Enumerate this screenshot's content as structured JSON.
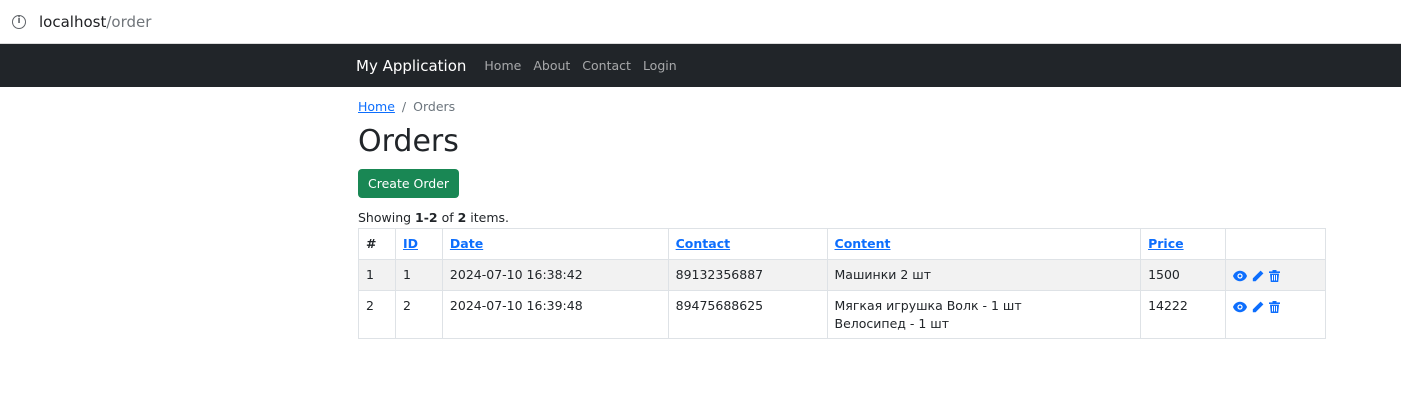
{
  "browser": {
    "url_host": "localhost",
    "url_path": "/order"
  },
  "navbar": {
    "brand": "My Application",
    "links": [
      "Home",
      "About",
      "Contact",
      "Login"
    ]
  },
  "breadcrumb": {
    "home": "Home",
    "separator": "/",
    "current": "Orders"
  },
  "page": {
    "title": "Orders",
    "create_button": "Create Order"
  },
  "summary": {
    "prefix": "Showing ",
    "range": "1-2",
    "middle": " of ",
    "total": "2",
    "suffix": " items."
  },
  "table": {
    "headers": [
      "#",
      "ID",
      "Date",
      "Contact",
      "Content",
      "Price",
      ""
    ],
    "rows": [
      {
        "num": "1",
        "id": "1",
        "date": "2024-07-10 16:38:42",
        "contact": "89132356887",
        "content_lines": [
          "Машинки 2 шт"
        ],
        "price": "1500"
      },
      {
        "num": "2",
        "id": "2",
        "date": "2024-07-10 16:39:48",
        "contact": "89475688625",
        "content_lines": [
          "Мягкая игрушка Волк - 1 шт",
          "Велосипед - 1 шт"
        ],
        "price": "14222"
      }
    ],
    "action_icons": [
      "eye-icon",
      "pencil-icon",
      "trash-icon"
    ]
  },
  "colors": {
    "navbar_bg": "#212529",
    "primary": "#0d6efd",
    "success": "#198754",
    "stripe": "#f2f2f2"
  }
}
